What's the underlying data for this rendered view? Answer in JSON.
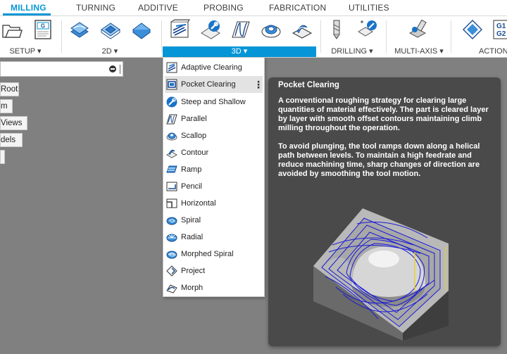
{
  "tabs": [
    {
      "label": "MILLING",
      "active": true
    },
    {
      "label": "TURNING"
    },
    {
      "label": "ADDITIVE"
    },
    {
      "label": "PROBING"
    },
    {
      "label": "FABRICATION"
    },
    {
      "label": "UTILITIES"
    }
  ],
  "ribbon": {
    "groups": [
      {
        "label": "SETUP ▾"
      },
      {
        "label": "2D ▾"
      },
      {
        "label": "3D ▾",
        "active": true
      },
      {
        "label": "DRILLING ▾"
      },
      {
        "label": "MULTI-AXIS ▾"
      },
      {
        "label": "ACTION"
      }
    ],
    "nc_icon_text": "G",
    "gcode_icon_text": "G1\nG2",
    "tool_icons": [
      "new-folder-icon",
      "nc-program-icon",
      "2d-adaptive-icon",
      "2d-pocket-icon",
      "face-icon",
      "3d-adaptive-icon",
      "steep-shallow-icon",
      "parallel-icon",
      "scallop-icon",
      "contour-icon",
      "drill-icon",
      "hole-recognition-icon",
      "multi-axis-icon",
      "simulate-icon",
      "post-process-icon"
    ],
    "accent": "#0696d7"
  },
  "browser": {
    "search_value": "",
    "items": [
      "Root",
      "m",
      "Views",
      "dels",
      ""
    ]
  },
  "menu": {
    "items": [
      {
        "label": "Adaptive Clearing",
        "icon": "adaptive-clearing-icon"
      },
      {
        "label": "Pocket Clearing",
        "icon": "pocket-clearing-icon",
        "highlighted": true
      },
      {
        "label": "Steep and Shallow",
        "icon": "steep-and-shallow-icon"
      },
      {
        "label": "Parallel",
        "icon": "parallel-icon"
      },
      {
        "label": "Scallop",
        "icon": "scallop-icon"
      },
      {
        "label": "Contour",
        "icon": "contour-icon"
      },
      {
        "label": "Ramp",
        "icon": "ramp-icon"
      },
      {
        "label": "Pencil",
        "icon": "pencil-icon"
      },
      {
        "label": "Horizontal",
        "icon": "horizontal-icon"
      },
      {
        "label": "Spiral",
        "icon": "spiral-icon"
      },
      {
        "label": "Radial",
        "icon": "radial-icon"
      },
      {
        "label": "Morphed Spiral",
        "icon": "morphed-spiral-icon"
      },
      {
        "label": "Project",
        "icon": "project-icon"
      },
      {
        "label": "Morph",
        "icon": "morph-icon"
      }
    ],
    "more_glyph": "⋮"
  },
  "tooltip": {
    "title": "Pocket Clearing",
    "paragraph1": "A conventional roughing strategy for clearing large quantities of material effectively. The part is cleared layer by layer with smooth offset contours maintaining climb milling throughout the operation.",
    "paragraph2": "To avoid plunging, the tool ramps down along a helical path between levels. To maintain a high feedrate and reduce machining time, sharp changes of direction are avoided by smoothing the tool motion."
  }
}
